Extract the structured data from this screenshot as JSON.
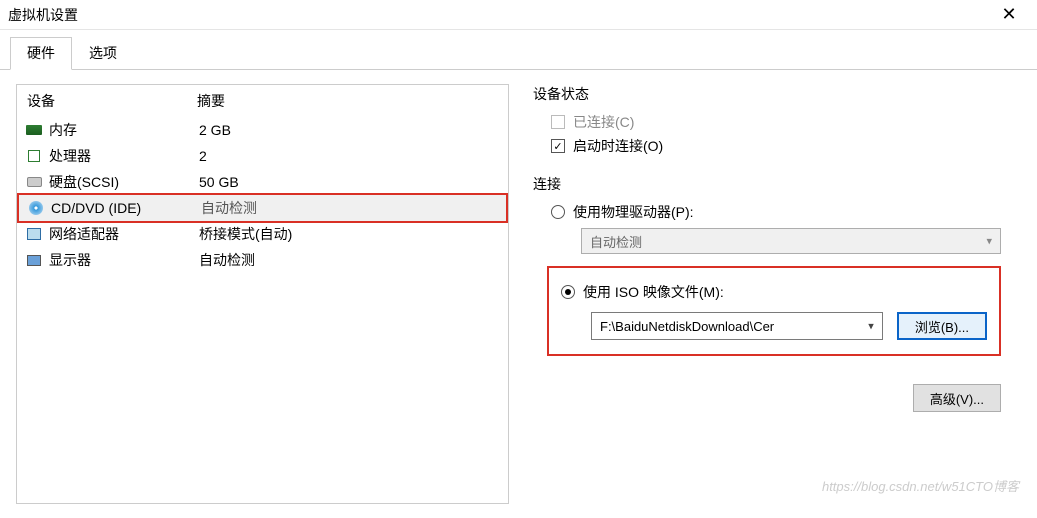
{
  "window": {
    "title": "虚拟机设置"
  },
  "tabs": [
    {
      "label": "硬件",
      "active": true
    },
    {
      "label": "选项",
      "active": false
    }
  ],
  "deviceTable": {
    "headers": {
      "device": "设备",
      "summary": "摘要"
    },
    "rows": [
      {
        "name": "内存",
        "summary": "2 GB",
        "icon": "memory"
      },
      {
        "name": "处理器",
        "summary": "2",
        "icon": "cpu"
      },
      {
        "name": "硬盘(SCSI)",
        "summary": "50 GB",
        "icon": "hdd"
      },
      {
        "name": "CD/DVD (IDE)",
        "summary": "自动检测",
        "icon": "cd",
        "selected": true
      },
      {
        "name": "网络适配器",
        "summary": "桥接模式(自动)",
        "icon": "net"
      },
      {
        "name": "显示器",
        "summary": "自动检测",
        "icon": "display"
      }
    ]
  },
  "deviceStatus": {
    "title": "设备状态",
    "connected": {
      "label": "已连接(C)",
      "checked": false,
      "enabled": false
    },
    "connectAtPowerOn": {
      "label": "启动时连接(O)",
      "checked": true,
      "enabled": true
    }
  },
  "connection": {
    "title": "连接",
    "physical": {
      "label": "使用物理驱动器(P):",
      "selected": false
    },
    "physicalCombo": {
      "value": "自动检测",
      "enabled": false
    },
    "iso": {
      "label": "使用 ISO 映像文件(M):",
      "selected": true
    },
    "isoCombo": {
      "value": "F:\\BaiduNetdiskDownload\\Cer"
    },
    "browseButton": "浏览(B)..."
  },
  "advancedButton": "高级(V)...",
  "watermark": "https://blog.csdn.net/w51CTO博客"
}
